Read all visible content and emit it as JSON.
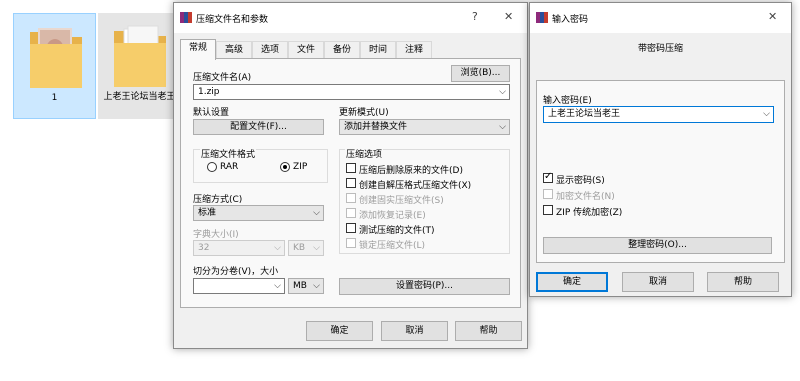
{
  "desktop": {
    "icons": [
      {
        "label": "1"
      },
      {
        "label": "上老王论坛当老王"
      }
    ]
  },
  "archive_dialog": {
    "title": "压缩文件名和参数",
    "help_glyph": "?",
    "close_glyph": "✕",
    "tabs": [
      "常规",
      "高级",
      "选项",
      "文件",
      "备份",
      "时间",
      "注释"
    ],
    "archive_name_label": "压缩文件名(A)",
    "browse_button": "浏览(B)...",
    "archive_name_value": "1.zip",
    "default_settings_label": "默认设置",
    "profiles_button": "配置文件(F)...",
    "update_mode_label": "更新模式(U)",
    "update_mode_value": "添加并替换文件",
    "format_group_label": "压缩文件格式",
    "format_rar": "RAR",
    "format_zip": "ZIP",
    "compression_method_label": "压缩方式(C)",
    "compression_method_value": "标准",
    "dictionary_label": "字典大小(I)",
    "dictionary_value": "32",
    "dictionary_unit": "KB",
    "split_label": "切分为分卷(V)，大小",
    "split_value": "",
    "split_unit": "MB",
    "options_group_label": "压缩选项",
    "options": [
      {
        "label": "压缩后删除原来的文件(D)",
        "checked": false,
        "disabled": false
      },
      {
        "label": "创建自解压格式压缩文件(X)",
        "checked": false,
        "disabled": false
      },
      {
        "label": "创建固实压缩文件(S)",
        "checked": false,
        "disabled": true
      },
      {
        "label": "添加恢复记录(E)",
        "checked": false,
        "disabled": true
      },
      {
        "label": "测试压缩的文件(T)",
        "checked": false,
        "disabled": false
      },
      {
        "label": "锁定压缩文件(L)",
        "checked": false,
        "disabled": true
      }
    ],
    "set_password_button": "设置密码(P)...",
    "ok_button": "确定",
    "cancel_button": "取消",
    "help_button": "帮助"
  },
  "password_dialog": {
    "title": "输入密码",
    "close_glyph": "✕",
    "heading": "带密码压缩",
    "enter_password_label": "输入密码(E)",
    "password_value": "上老王论坛当老王",
    "options": [
      {
        "label": "显示密码(S)",
        "checked": true,
        "disabled": false
      },
      {
        "label": "加密文件名(N)",
        "checked": false,
        "disabled": true
      },
      {
        "label": "ZIP 传统加密(Z)",
        "checked": false,
        "disabled": false
      }
    ],
    "organize_button": "整理密码(O)...",
    "ok_button": "确定",
    "cancel_button": "取消",
    "help_button": "帮助"
  },
  "colors": {
    "accent": "#0078d7",
    "selection": "#cce8ff",
    "folder": "#f4c75e"
  }
}
